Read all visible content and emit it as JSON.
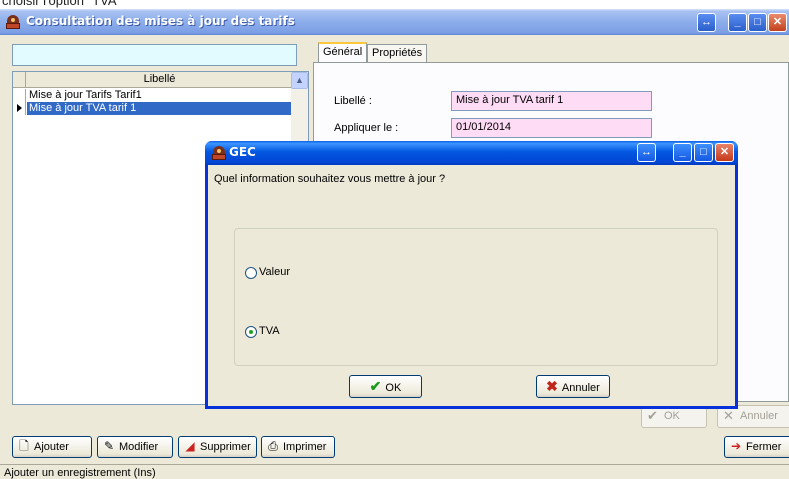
{
  "top_caption": {
    "text": "choisir l'option \"TVA\""
  },
  "window": {
    "title": "Consultation des mises à jour des tarifs",
    "buttons": {
      "resize": "↔",
      "minimize": "_",
      "maximize": "□",
      "close": "✕"
    }
  },
  "list": {
    "search_value": "",
    "column_header": "Libellé",
    "rows": [
      {
        "label": "Mise à jour Tarifs Tarif1",
        "selected": false
      },
      {
        "label": "Mise à jour TVA tarif 1",
        "selected": true
      }
    ],
    "scroll": {
      "up": "▲",
      "down": "▼"
    }
  },
  "tabs": [
    {
      "label": "Général",
      "active": true
    },
    {
      "label": "Propriétés",
      "active": false
    }
  ],
  "form": {
    "libelle_label": "Libellé :",
    "libelle_value": "Mise à jour TVA tarif 1",
    "appliquer_label": "Appliquer le :",
    "appliquer_value": "01/01/2014"
  },
  "right_buttons": {
    "ok": "OK",
    "annuler": "Annuler",
    "fermer": "Fermer"
  },
  "toolbar": {
    "ajouter": "Ajouter",
    "modifier": "Modifier",
    "supprimer": "Supprimer",
    "imprimer": "Imprimer"
  },
  "statusbar": {
    "text": "Ajouter un enregistrement (Ins)"
  },
  "dialog": {
    "title": "GEC",
    "question": "Quel information souhaitez vous mettre à jour ?",
    "options": [
      {
        "label": "Valeur",
        "checked": false
      },
      {
        "label": "TVA",
        "checked": true
      }
    ],
    "ok": "OK",
    "annuler": "Annuler"
  },
  "icons": {
    "ajouter": "page-icon",
    "modifier": "edit-icon",
    "supprimer": "eraser-icon",
    "imprimer": "printer-icon",
    "fermer": "exit-icon",
    "ok": "checkmark-icon",
    "annuler": "x-icon"
  },
  "colors": {
    "title_bar": "#8cadeb",
    "dialog_title_bar": "#0257e0",
    "selection": "#3169c6",
    "field_background": "#ffdcf6",
    "search_background": "#e1fbff"
  }
}
